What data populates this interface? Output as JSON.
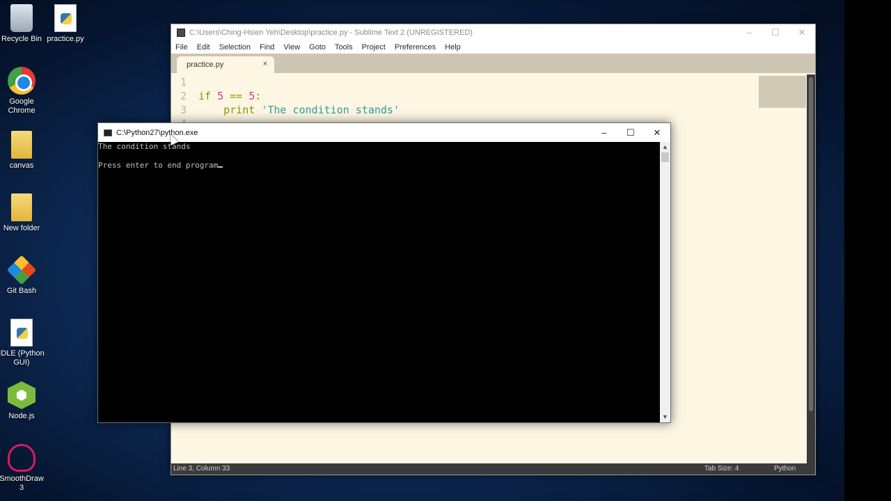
{
  "desktop": {
    "icons": [
      {
        "label": "Recycle Bin",
        "icon": "recycle-bin-icon"
      },
      {
        "label": "practice.py",
        "icon": "python-file-icon"
      },
      {
        "label": "Google Chrome",
        "icon": "chrome-icon"
      },
      {
        "label": "canvas",
        "icon": "folder-icon"
      },
      {
        "label": "New folder",
        "icon": "folder-icon"
      },
      {
        "label": "Git Bash",
        "icon": "git-bash-icon"
      },
      {
        "label": "IDLE (Python GUI)",
        "icon": "idle-python-icon"
      },
      {
        "label": "Node.js",
        "icon": "nodejs-icon"
      },
      {
        "label": "SmoothDraw 3",
        "icon": "smoothdraw-icon"
      }
    ]
  },
  "sublime": {
    "title": "C:\\Users\\Ching-Hsien Yeh\\Desktop\\practice.py - Sublime Text 2 (UNREGISTERED)",
    "window_controls": {
      "minimize": "–",
      "maximize": "☐",
      "close": "✕"
    },
    "menu": [
      "File",
      "Edit",
      "Selection",
      "Find",
      "View",
      "Goto",
      "Tools",
      "Project",
      "Preferences",
      "Help"
    ],
    "tab": {
      "label": "practice.py",
      "close": "×"
    },
    "line_numbers": [
      "1",
      "2",
      "3",
      "4"
    ],
    "code": {
      "line2": {
        "kw": "if",
        "n1": "5",
        "op": "==",
        "n2": "5",
        "colon": ":"
      },
      "line3": {
        "kw": "print",
        "str": "'The condition stands'"
      }
    },
    "status": {
      "position": "Line 3, Column 33",
      "tab_size": "Tab Size: 4",
      "syntax": "Python"
    }
  },
  "console": {
    "title": "C:\\Python27\\python.exe",
    "window_controls": {
      "minimize": "–",
      "maximize": "☐",
      "close": "✕"
    },
    "lines": [
      "The condition stands",
      "Press enter to end program"
    ],
    "scroll_up": "▲",
    "scroll_down": "▼"
  }
}
